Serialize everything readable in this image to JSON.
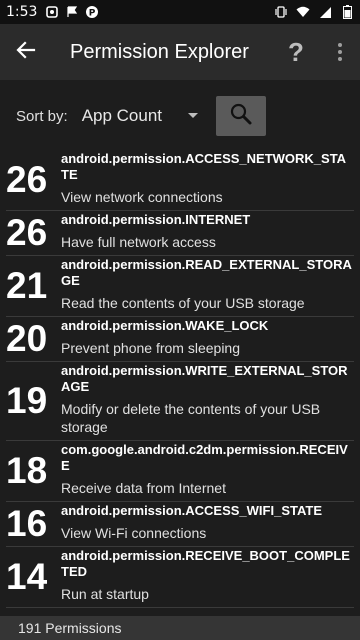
{
  "status_bar": {
    "time": "1:53",
    "icons": [
      "notification-icon",
      "flag-icon",
      "app-p-icon",
      "vibrate-icon",
      "wifi-icon",
      "cellular-icon",
      "battery-icon"
    ]
  },
  "app_bar": {
    "title": "Permission Explorer",
    "help_label": "?",
    "icons": [
      "back-arrow-icon",
      "help-icon",
      "overflow-menu-icon"
    ]
  },
  "sort": {
    "label": "Sort by:",
    "value": "App Count"
  },
  "permissions": [
    {
      "count": "26",
      "name": "android.permission.ACCESS_NETWORK_STATE",
      "desc": "View network connections"
    },
    {
      "count": "26",
      "name": "android.permission.INTERNET",
      "desc": "Have full network access"
    },
    {
      "count": "21",
      "name": "android.permission.READ_EXTERNAL_STORAGE",
      "desc": "Read the contents of your USB storage"
    },
    {
      "count": "20",
      "name": "android.permission.WAKE_LOCK",
      "desc": "Prevent phone from sleeping"
    },
    {
      "count": "19",
      "name": "android.permission.WRITE_EXTERNAL_STORAGE",
      "desc": "Modify or delete the contents of your USB storage"
    },
    {
      "count": "18",
      "name": "com.google.android.c2dm.permission.RECEIVE",
      "desc": "Receive data from Internet"
    },
    {
      "count": "16",
      "name": "android.permission.ACCESS_WIFI_STATE",
      "desc": "View Wi-Fi connections"
    },
    {
      "count": "14",
      "name": "android.permission.RECEIVE_BOOT_COMPLETED",
      "desc": "Run at startup"
    }
  ],
  "footer": {
    "count_text": "191 Permissions"
  },
  "colors": {
    "background": "#1d1d1d",
    "app_bar": "#2b2b2b",
    "status_bar": "#111111",
    "search_button": "#5a5a5a",
    "footer": "#353535"
  }
}
